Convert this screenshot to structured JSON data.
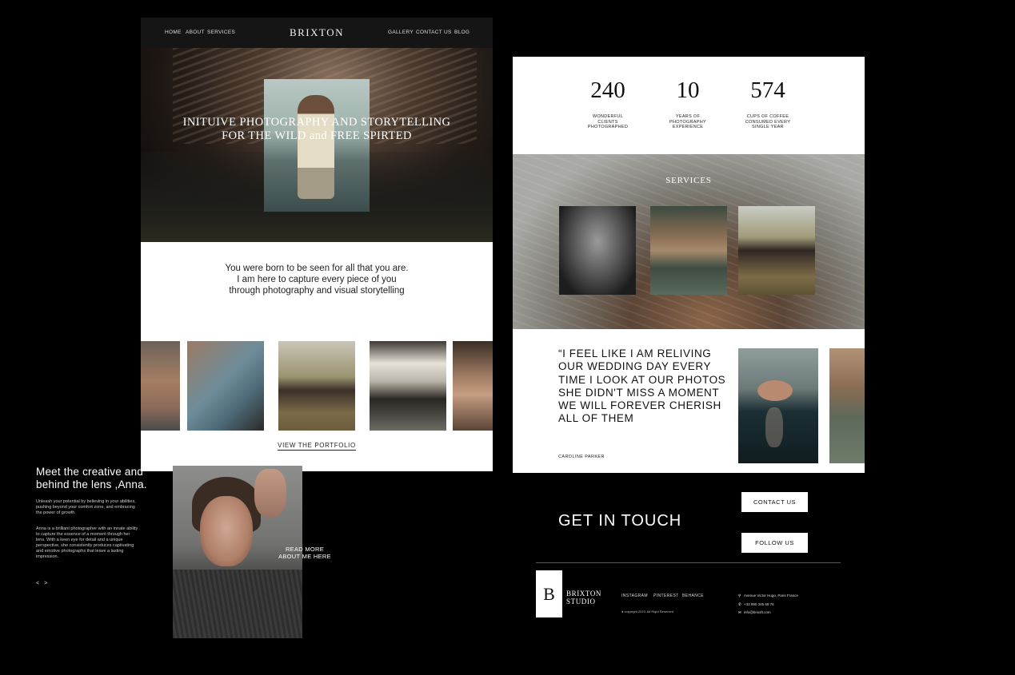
{
  "left_page": {
    "nav": {
      "left_links": [
        "HOME",
        "ABOUT",
        "SERVICES"
      ],
      "brand": "BRIXTON",
      "right_links": [
        "GALLERY",
        "CONTACT US",
        "BLOG"
      ]
    },
    "hero": {
      "title_line1": "INITUIVE PHOTOGRAPHY AND STORYTELLING",
      "title_line2": "FOR THE WILD and FREE SPIRTED"
    },
    "intro": {
      "text": "You were born to be seen for all that you are. I am here to capture every piece of you through photography and visual storytelling",
      "portfolio_link": "VIEW THE PORTFOLIO"
    },
    "about": {
      "heading_line1": "Meet the creative and",
      "heading_line2": "behind the lens ,Anna.",
      "paragraph1": "Unleash your potential by believing in your abilities, pushing beyond your comfort zone, and embracing the power of growth.",
      "paragraph2": "Anna is a brilliant photographer with an innate ability to capture the essence of a moment through her lens. With a keen eye for detail and a unique perspective, she consistently produces captivating and emotive photographs that leave a lasting impression.",
      "prev_arrow": "<",
      "next_arrow": ">",
      "read_more_line1": "READ MORE",
      "read_more_line2": "ABOUT ME HERE"
    }
  },
  "right_page": {
    "stats": [
      {
        "value": "240",
        "label": "WONDERFUL CLIENTS PHOTOGRAPHED"
      },
      {
        "value": "10",
        "label": "YEARS OF PHOTOGRAPHY EXPERIENCE"
      },
      {
        "value": "574",
        "label": "CUPS OF COFFEE CONSUMED EVERY SINGLE YEAR"
      }
    ],
    "services_title": "SERVICES",
    "testimonial": {
      "quote": "“I FEEL LIKE I AM RELIVING OUR WEDDING DAY EVERY TIME I LOOK AT OUR PHOTOS SHE DIDN'T MISS A MOMENT WE WILL FOREVER CHERISH ALL OF THEM",
      "author": "CAROLINE PARKER"
    },
    "cta": {
      "heading": "GET IN TOUCH",
      "contact_button": "CONTACT US",
      "follow_button": "FOLLOW US"
    },
    "footer": {
      "logo_letter": "B",
      "studio_line1": "BRIXTON",
      "studio_line2": "STUDIO",
      "social": [
        "INSTAGRAM",
        "PINTEREST",
        "BEHANCE"
      ],
      "copyright": "copyright 2023. All Right Reserved",
      "address": "Avenue Victor Hugo, Paris France",
      "phone": "+33 990 345 69 76",
      "email": "info@brixsft.com"
    }
  },
  "colors": {
    "background": "#000000",
    "panel": "#ffffff",
    "nav_bar": "#151515",
    "text_light": "#ffffff"
  }
}
